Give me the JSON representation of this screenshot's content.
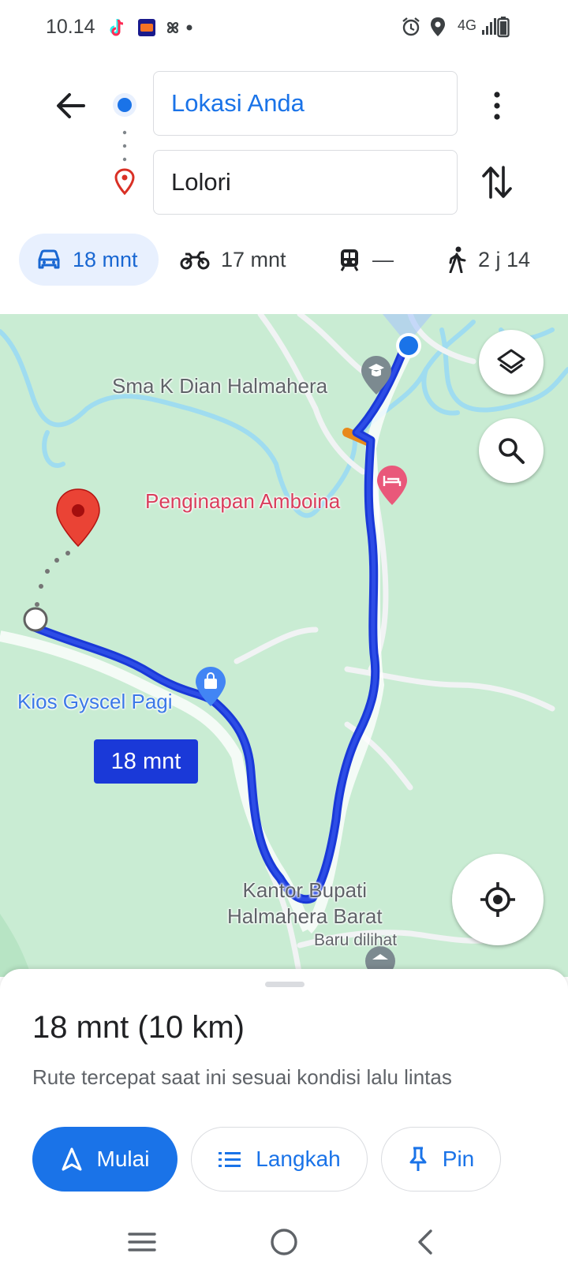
{
  "status_bar": {
    "time": "10.14",
    "network": "4G",
    "notification_icons": [
      "tiktok-icon",
      "lazada-icon",
      "pinwheel-icon",
      "dot-icon"
    ],
    "system_icons": [
      "alarm-icon",
      "location-icon",
      "signal-icon",
      "battery-icon"
    ]
  },
  "directions": {
    "origin": "Lokasi Anda",
    "destination": "Lolori",
    "modes": [
      {
        "mode": "car",
        "label": "18 mnt",
        "selected": true
      },
      {
        "mode": "motorcycle",
        "label": "17 mnt",
        "selected": false
      },
      {
        "mode": "transit",
        "label": "—",
        "selected": false
      },
      {
        "mode": "walk",
        "label": "2 j 14",
        "selected": false
      }
    ]
  },
  "map": {
    "labels": {
      "school": "Sma K Dian Halmahera",
      "inn": "Penginapan Amboina",
      "kios": "Kios Gyscel Pagi",
      "kantor_line1": "Kantor Bupati",
      "kantor_line2": "Halmahera Barat",
      "recent": "Baru dilihat"
    },
    "route_duration_chip": "18 mnt",
    "colors": {
      "route": "#1a39d8",
      "traffic_slow": "#e8891a",
      "land": "#c9ecd3",
      "water": "#9fdcf0",
      "origin": "#1a73e8",
      "destination_pin": "#ea4335"
    }
  },
  "sheet": {
    "summary": "18 mnt (10 km)",
    "description": "Rute tercepat saat ini sesuai kondisi lalu lintas",
    "buttons": {
      "start": "Mulai",
      "steps": "Langkah",
      "pin": "Pin"
    }
  }
}
